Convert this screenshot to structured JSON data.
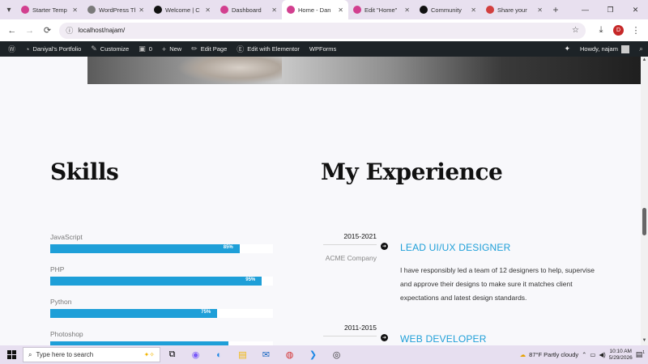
{
  "browser": {
    "tabs": [
      {
        "label": "Starter Temp",
        "color": "#d23f8f",
        "active": false
      },
      {
        "label": "WordPress Th",
        "color": "#7a7a7a",
        "active": false
      },
      {
        "label": "Welcome | C",
        "color": "#111111",
        "active": false
      },
      {
        "label": "Dashboard",
        "color": "#d23f8f",
        "active": false
      },
      {
        "label": "Home - Dan",
        "color": "#d23f8f",
        "active": true
      },
      {
        "label": "Edit \"Home\"",
        "color": "#d23f8f",
        "active": false
      },
      {
        "label": "Community",
        "color": "#111111",
        "active": false
      },
      {
        "label": "Share your",
        "color": "#d23f3f",
        "active": false
      }
    ],
    "address": "localhost/najam/",
    "profile_initial": "D"
  },
  "adminbar": {
    "site": "Daniyal's Portfolio",
    "customize": "Customize",
    "comments": "0",
    "new": "New",
    "edit_page": "Edit Page",
    "elementor": "Edit with Elementor",
    "wpforms": "WPForms",
    "howdy": "Howdy, najam"
  },
  "skills": {
    "heading": "Skills",
    "items": [
      {
        "name": "JavaScript",
        "percent": 85,
        "label": "85%"
      },
      {
        "name": "PHP",
        "percent": 95,
        "label": "95%"
      },
      {
        "name": "Python",
        "percent": 75,
        "label": "75%"
      },
      {
        "name": "Photoshop",
        "percent": 80,
        "label": ""
      }
    ]
  },
  "experience": {
    "heading": "My Experience",
    "items": [
      {
        "years": "2015-2021",
        "company": "ACME Company",
        "title": "LEAD UI/UX DESIGNER",
        "description": "I have responsibly led a team of 12 designers to help, supervise and approve their designs to make sure it matches client expectations and latest design standards."
      },
      {
        "years": "2011-2015",
        "title": "WEB DEVELOPER"
      }
    ]
  },
  "taskbar": {
    "search_placeholder": "Type here to search",
    "weather": "87°F  Partly cloudy",
    "time": "10:10 AM",
    "date": "5/29/2026",
    "notification_count": "1"
  }
}
